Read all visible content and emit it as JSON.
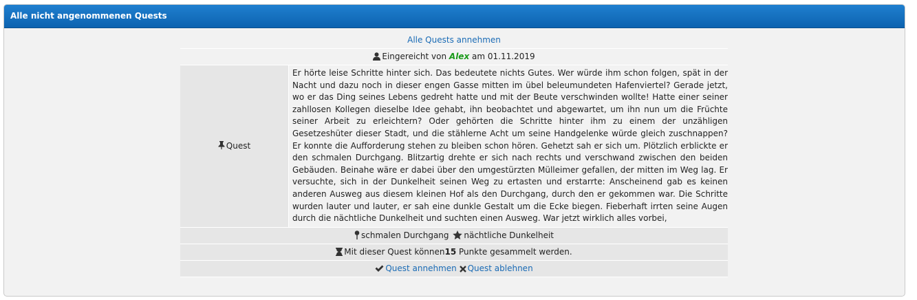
{
  "panel": {
    "title": "Alle nicht angenommenen Quests"
  },
  "accept_all_label": "Alle Quests annehmen",
  "submission": {
    "prefix": "Eingereicht von",
    "author": "Alex",
    "date_prefix": "am",
    "date": "01.11.2019"
  },
  "quest": {
    "label": "Quest",
    "text": "Er hörte leise Schritte hinter sich. Das bedeutete nichts Gutes. Wer würde ihm schon folgen, spät in der Nacht und dazu noch in dieser engen Gasse mitten im übel beleumundeten Hafenviertel? Gerade jetzt, wo er das Ding seines Lebens gedreht hatte und mit der Beute verschwinden wollte! Hatte einer seiner zahllosen Kollegen dieselbe Idee gehabt, ihn beobachtet und abgewartet, um ihn nun um die Früchte seiner Arbeit zu erleichtern? Oder gehörten die Schritte hinter ihm zu einem der unzähligen Gesetzeshüter dieser Stadt, und die stählerne Acht um seine Handgelenke würde gleich zuschnappen? Er konnte die Aufforderung stehen zu bleiben schon hören. Gehetzt sah er sich um. Plötzlich erblickte er den schmalen Durchgang. Blitzartig drehte er sich nach rechts und verschwand zwischen den beiden Gebäuden. Beinahe wäre er dabei über den umgestürzten Mülleimer gefallen, der mitten im Weg lag. Er versuchte, sich in der Dunkelheit seinen Weg zu ertasten und erstarrte: Anscheinend gab es keinen anderen Ausweg aus diesem kleinen Hof als den Durchgang, durch den er gekommen war. Die Schritte wurden lauter und lauter, er sah eine dunkle Gestalt um die Ecke biegen. Fieberhaft irrten seine Augen durch die nächtliche Dunkelheit und suchten einen Ausweg. War jetzt wirklich alles vorbei,"
  },
  "keywords": {
    "first": "schmalen Durchgang",
    "second": "nächtliche Dunkelheit"
  },
  "points": {
    "prefix": "Mit dieser Quest können",
    "value": "15",
    "suffix": "Punkte gesammelt werden."
  },
  "actions": {
    "accept_label": "Quest annehmen",
    "reject_label": "Quest ablehnen"
  },
  "colors": {
    "header_blue": "#0d63b0",
    "link_blue": "#1a6bb5",
    "author_green": "#1a9a1a"
  },
  "icons": [
    "user-icon",
    "pin-icon",
    "map-marker-icon",
    "star-icon",
    "hourglass-icon",
    "check-icon",
    "close-icon"
  ]
}
